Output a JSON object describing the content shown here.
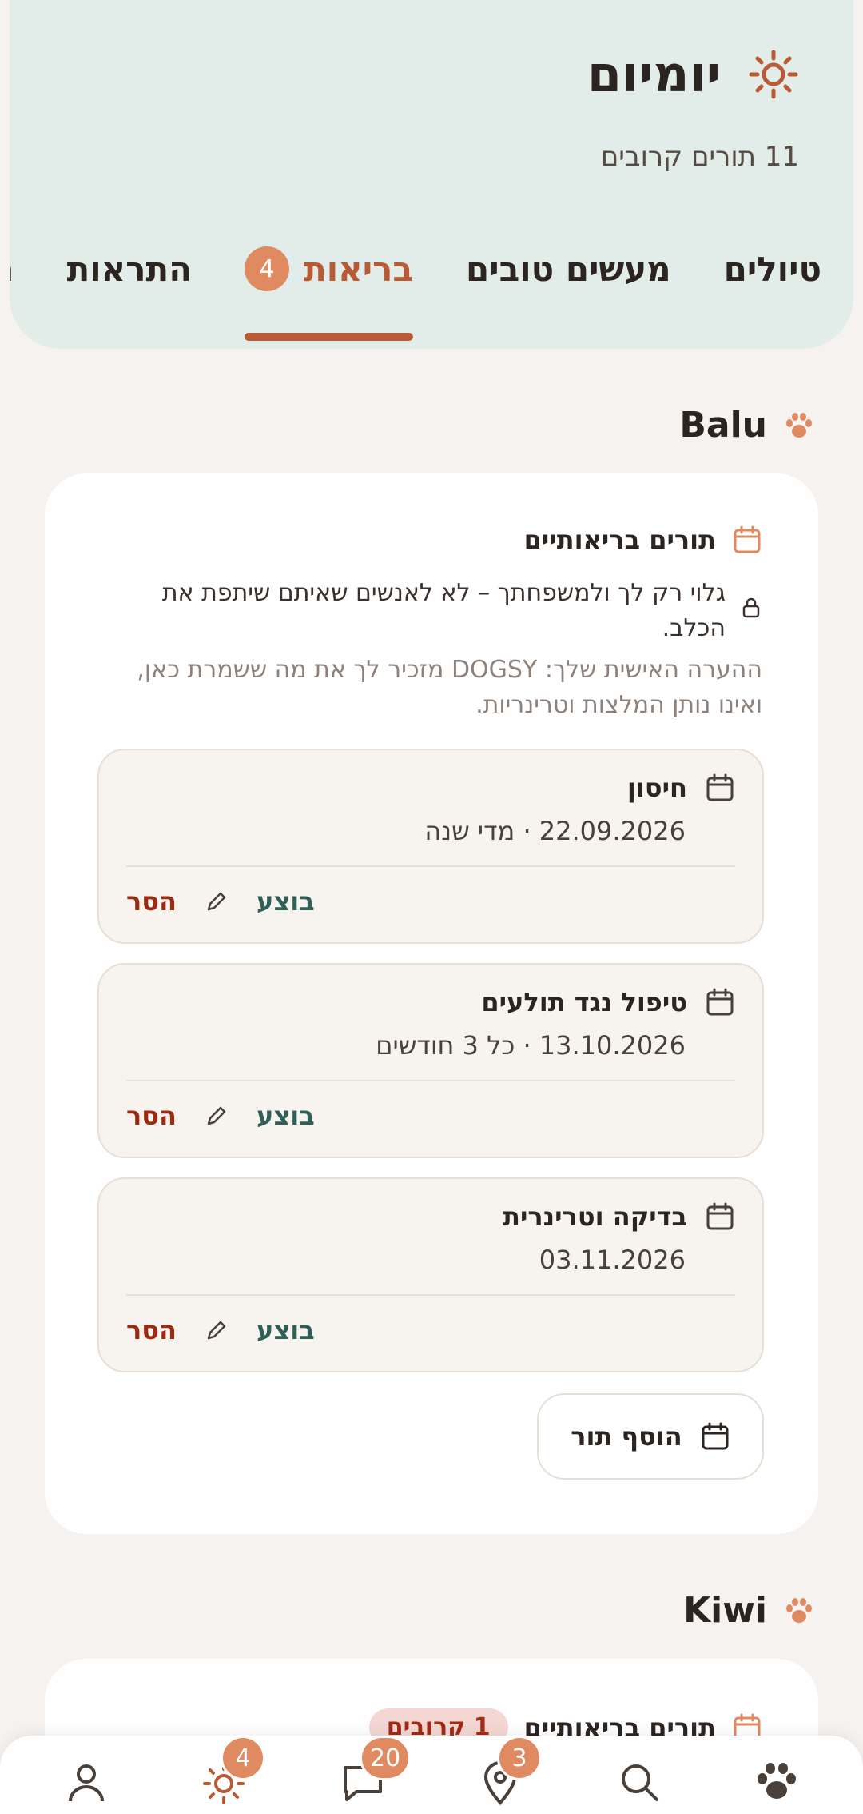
{
  "header": {
    "title": "יומיום",
    "subtitle": "11 תורים קרובים",
    "tabs": [
      {
        "label": "טיולים"
      },
      {
        "label": "מעשים טובים"
      },
      {
        "label": "בריאות",
        "badge": "4",
        "active": true
      },
      {
        "label": "התראות"
      },
      {
        "label": "נ"
      }
    ]
  },
  "dogs": [
    {
      "name": "Balu",
      "section_title": "תורים בריאותיים",
      "private_note": "גלוי רק לך ולמשפחתך – לא לאנשים שאיתם שיתפת את הכלב.",
      "disclaimer": "ההערה האישית שלך: DOGSY מזכיר לך את מה ששמרת כאן, ואינו נותן המלצות וטרינריות.",
      "appointments": [
        {
          "title": "חיסון",
          "date": "22.09.2026 · מדי שנה"
        },
        {
          "title": "טיפול נגד תולעים",
          "date": "13.10.2026 · כל 3 חודשים"
        },
        {
          "title": "בדיקה וטרינרית",
          "date": "03.11.2026"
        }
      ],
      "actions": {
        "done": "בוצע",
        "remove": "הסר"
      },
      "add_label": "הוסף תור"
    },
    {
      "name": "Kiwi",
      "section_title": "תורים בריאותיים",
      "count_pill": "1 קרובים"
    }
  ],
  "bottom_nav": {
    "badges": {
      "daily": "4",
      "messages": "20",
      "places": "3"
    }
  },
  "colors": {
    "accent": "#b85a33",
    "badge": "#e08a62",
    "header_bg": "#e2ece8",
    "done": "#2f5f57",
    "remove": "#9b2c12"
  }
}
